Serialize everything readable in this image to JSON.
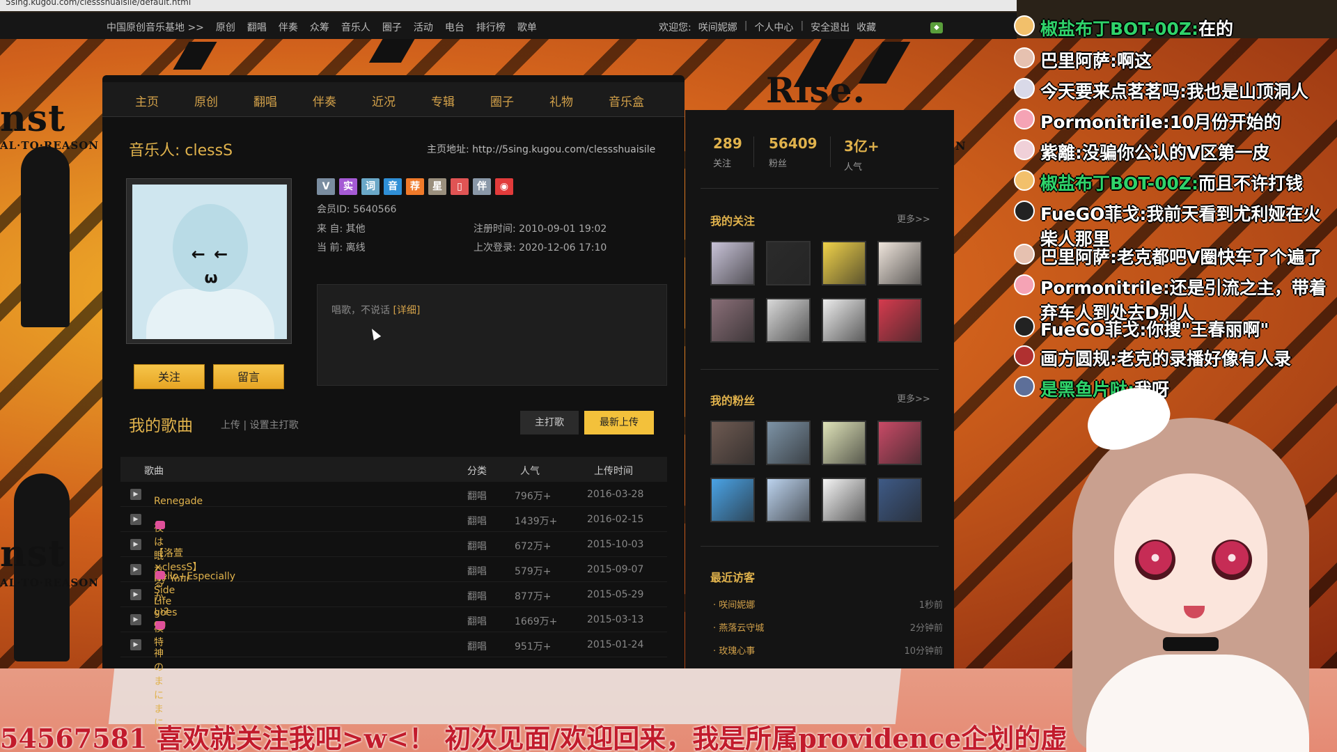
{
  "browser": {
    "url_fragment": "5sing.kugou.com/clessshuaisile/default.html"
  },
  "topnav": {
    "left": [
      "中国原创音乐基地 >>",
      "原创",
      "翻唱",
      "伴奏",
      "众筹",
      "音乐人",
      "圈子",
      "活动",
      "电台",
      "排行榜",
      "歌单"
    ],
    "welcome": "欢迎您:",
    "username": "咲间妮娜",
    "sep": "|",
    "personal_center": "个人中心",
    "logout": "安全退出",
    "favorite": "收藏"
  },
  "tabs": [
    "主页",
    "原创",
    "翻唱",
    "伴奏",
    "近况",
    "专辑",
    "圈子",
    "礼物",
    "音乐盒"
  ],
  "profile": {
    "title": "音乐人: clessS",
    "homepage": "主页地址: http://5sing.kugou.com/clessshuaisile",
    "member_id": "会员ID: 5640566",
    "from": "来 自: 其他",
    "status": "当 前: 离线",
    "registered": "注册时间: 2010-09-01 19:02",
    "last_login": "上次登录: 2020-12-06 17:10",
    "avatar_face": "←  ←",
    "avatar_mouth": "ω",
    "follow_button": "关注",
    "message_button": "留言",
    "bio": "唱歌，不说话",
    "bio_more": "[详细]"
  },
  "badges": [
    {
      "label": "V",
      "color": "#7a8da0"
    },
    {
      "label": "实",
      "color": "#a55ad4"
    },
    {
      "label": "词",
      "color": "#6aa8c8"
    },
    {
      "label": "音",
      "color": "#2f8fd6"
    },
    {
      "label": "荐",
      "color": "#f07a2a"
    },
    {
      "label": "星",
      "color": "#9a8f7d"
    },
    {
      "label": "▯",
      "color": "#e05454"
    },
    {
      "label": "伴",
      "color": "#8a98a8"
    },
    {
      "label": "◉",
      "color": "#e23b3b"
    }
  ],
  "songs": {
    "title": "我的歌曲",
    "upload": "上传",
    "set_main": "设置主打歌",
    "sep": "|",
    "main_button": "主打歌",
    "latest_button": "最新上传",
    "columns": [
      "歌曲",
      "分类",
      "人气",
      "上传时间"
    ],
    "rows": [
      {
        "name": "Renegade",
        "category": "翻唱",
        "popularity": "796万+",
        "date": "2016-03-28",
        "tag": false
      },
      {
        "name": "夜は眠れるかい?",
        "category": "翻唱",
        "popularity": "1439万+",
        "date": "2016-02-15",
        "tag": true
      },
      {
        "name": "【洛萱×clessS】By Your Side",
        "category": "翻唱",
        "popularity": "672万+",
        "date": "2015-10-03",
        "tag": false
      },
      {
        "name": "Hello+Especially",
        "category": "翻唱",
        "popularity": "579万+",
        "date": "2015-09-07",
        "tag": true
      },
      {
        "name": "Life goes on",
        "category": "翻唱",
        "popularity": "877万+",
        "date": "2015-05-29",
        "tag": false
      },
      {
        "name": "模特",
        "category": "翻唱",
        "popularity": "1669万+",
        "date": "2015-03-13",
        "tag": true
      },
      {
        "name": "神のまにまに",
        "category": "翻唱",
        "popularity": "951万+",
        "date": "2015-01-24",
        "tag": false
      }
    ]
  },
  "stats": [
    {
      "value": "289",
      "label": "关注"
    },
    {
      "value": "56409",
      "label": "粉丝"
    },
    {
      "value": "3亿+",
      "label": "人气"
    }
  ],
  "following": {
    "title": "我的关注",
    "more": "更多>>",
    "thumb_colors": [
      "#c9c3d8",
      "#2b2b2b",
      "#f0d24a",
      "#efe5dc",
      "#8a6f78",
      "#d9d9d9",
      "#ececec",
      "#d53b4e"
    ]
  },
  "fans": {
    "title": "我的粉丝",
    "more": "更多>>",
    "thumb_colors": [
      "#6e5a52",
      "#7d93a6",
      "#dfe3b9",
      "#c94a66",
      "#4aa3e6",
      "#bcd3ee",
      "#f4f4f4",
      "#3e5a86"
    ]
  },
  "visitors": {
    "title": "最近访客",
    "items": [
      {
        "name": "· 咲间妮娜",
        "time": "1秒前"
      },
      {
        "name": "· 燕落云守城",
        "time": "2分钟前"
      },
      {
        "name": "· 玫瑰心事",
        "time": "10分钟前"
      }
    ]
  },
  "chat": [
    {
      "nick": "椒盐布丁BOT-00Z:",
      "msg": "在的",
      "nick_color": "green",
      "avatar_color": "#f2c06b"
    },
    {
      "nick": "巴里阿萨:",
      "msg": "啊这",
      "nick_color": "white",
      "avatar_color": "#e6c1b0"
    },
    {
      "nick": "今天要来点茗茗吗:",
      "msg": "我也是山顶洞人",
      "nick_color": "white",
      "avatar_color": "#d9d9e8"
    },
    {
      "nick": "Pormonitrile:",
      "msg": "10月份开始的",
      "nick_color": "white",
      "avatar_color": "#f5a3b5"
    },
    {
      "nick": "紫離:",
      "msg": "没骗你公认的V区第一皮",
      "nick_color": "white",
      "avatar_color": "#f0d0d8"
    },
    {
      "nick": "椒盐布丁BOT-00Z:",
      "msg": "而且不许打钱",
      "nick_color": "green",
      "avatar_color": "#f2c06b"
    },
    {
      "nick": "FueGO菲戈:",
      "msg": "我前天看到尤利娅在火柴人那里",
      "nick_color": "white",
      "avatar_color": "#222"
    },
    {
      "nick": "巴里阿萨:",
      "msg": "老克都吧V圈快车了个遍了",
      "nick_color": "white",
      "avatar_color": "#e6c1b0"
    },
    {
      "nick": "Pormonitrile:",
      "msg": "还是引流之主，带着弃车人到处去D别人",
      "nick_color": "white",
      "avatar_color": "#f5a3b5"
    },
    {
      "nick": "FueGO菲戈:",
      "msg": "你搜\"王春丽啊\"",
      "nick_color": "white",
      "avatar_color": "#222"
    },
    {
      "nick": "画方圆规:",
      "msg": "老克的录播好像有人录",
      "nick_color": "white",
      "avatar_color": "#b03030"
    },
    {
      "nick": "是黑鱼片哒:",
      "msg": "我呀",
      "nick_color": "green",
      "avatar_color": "#5d6f99"
    }
  ],
  "ticker": "54567581 喜欢就关注我吧>w<！ 初次见面/欢迎回来，我是所属providence企划的虚",
  "background_texts": [
    "nst",
    "AL·TO·REASON",
    "Rise.",
    "N"
  ]
}
